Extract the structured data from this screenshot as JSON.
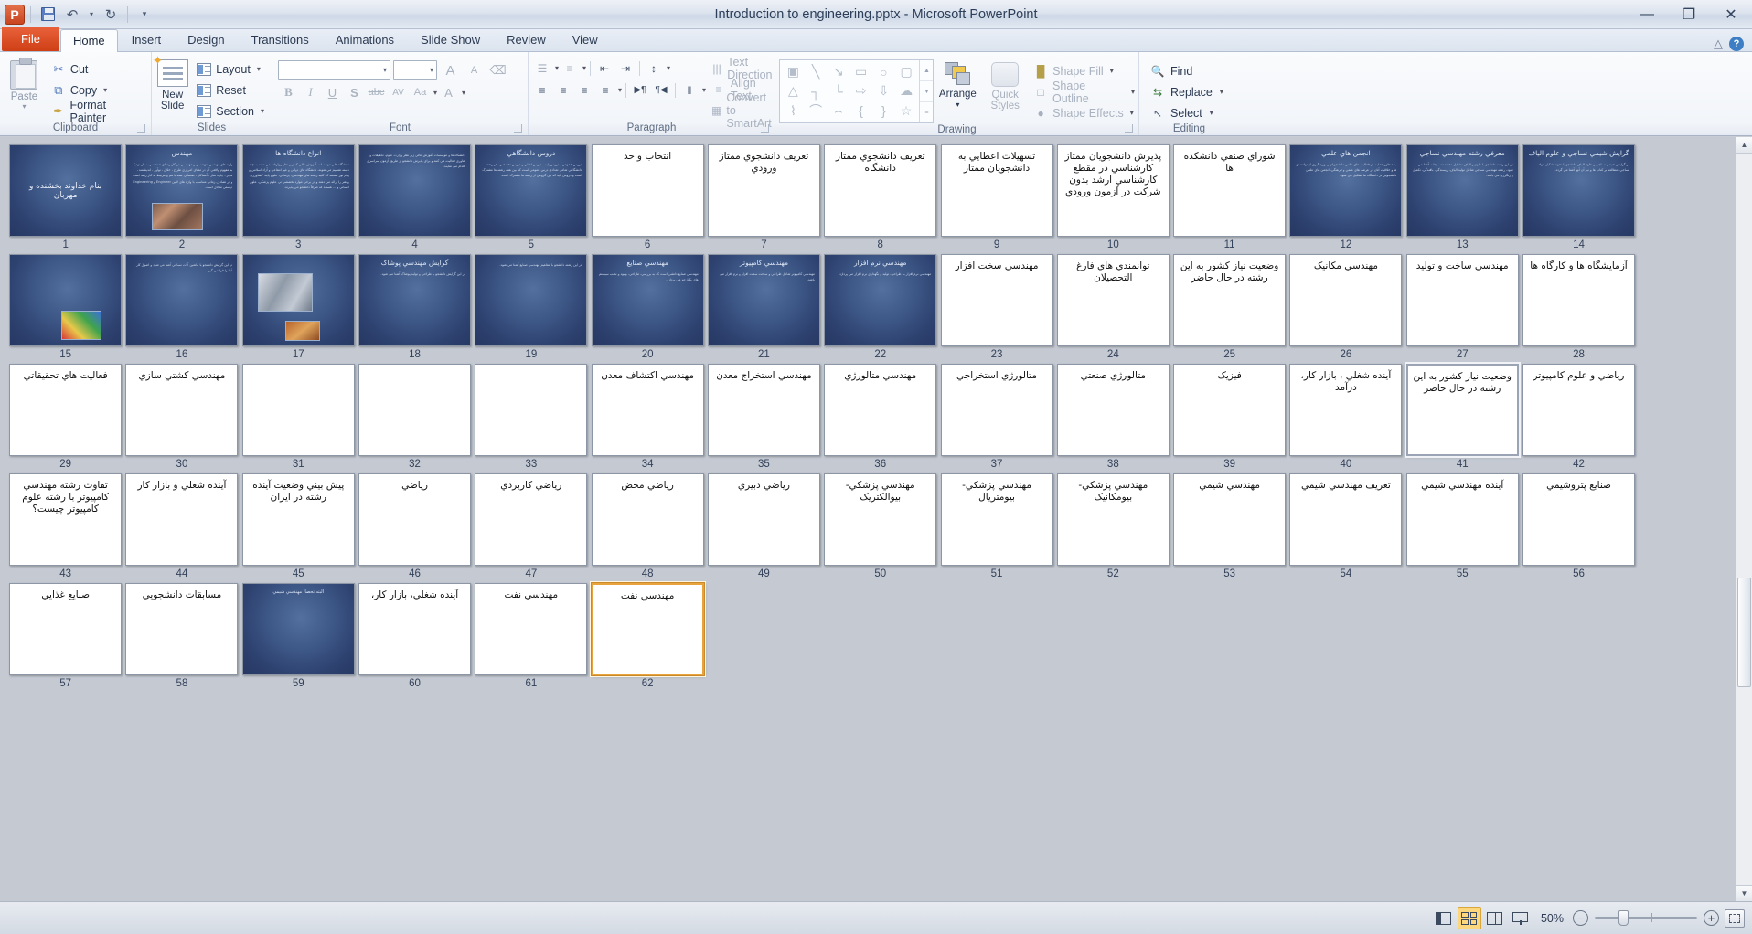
{
  "window": {
    "title": "Introduction to engineering.pptx  -  Microsoft PowerPoint",
    "app_logo": "P",
    "minimize": "—",
    "restore": "❐",
    "close": "✕"
  },
  "quick_access": {
    "save_tooltip": "Save",
    "undo": "↶",
    "undo_caret": "▾",
    "redo": "↻",
    "customize": "▾"
  },
  "tabs": [
    {
      "label": "File",
      "kind": "file"
    },
    {
      "label": "Home",
      "kind": "active"
    },
    {
      "label": "Insert",
      "kind": "normal"
    },
    {
      "label": "Design",
      "kind": "normal"
    },
    {
      "label": "Transitions",
      "kind": "normal"
    },
    {
      "label": "Animations",
      "kind": "normal"
    },
    {
      "label": "Slide Show",
      "kind": "normal"
    },
    {
      "label": "Review",
      "kind": "normal"
    },
    {
      "label": "View",
      "kind": "normal"
    }
  ],
  "tab_right": {
    "minimize_ribbon": "△",
    "help": "?"
  },
  "ribbon": {
    "groups": [
      {
        "name": "Clipboard",
        "label": "Clipboard"
      },
      {
        "name": "Slides",
        "label": "Slides"
      },
      {
        "name": "Font",
        "label": "Font"
      },
      {
        "name": "Paragraph",
        "label": "Paragraph"
      },
      {
        "name": "Drawing",
        "label": "Drawing"
      },
      {
        "name": "Editing",
        "label": "Editing"
      }
    ],
    "clipboard": {
      "paste": "Paste",
      "paste_caret": "▾",
      "cut": "Cut",
      "copy": "Copy",
      "format_painter": "Format Painter",
      "cut_icon": "✂",
      "copy_icon": "⧉",
      "painter_icon": "✒"
    },
    "slides": {
      "new_slide_line1": "New",
      "new_slide_line2": "Slide",
      "new_slide_caret": "▾",
      "layout": "Layout",
      "reset": "Reset",
      "section": "Section",
      "caret": "▾"
    },
    "font": {
      "font_name_value": "",
      "font_size_value": "",
      "grow_font": "A",
      "shrink_font": "A",
      "clear_formatting": "⌫",
      "bold": "B",
      "italic": "I",
      "underline": "U",
      "shadow": "S",
      "strikethrough": "abc",
      "char_spacing": "AV",
      "change_case": "Aa",
      "font_color": "A"
    },
    "paragraph": {
      "bullets": "☰",
      "numbering": "≡",
      "decrease_indent": "⇤",
      "increase_indent": "⇥",
      "line_spacing": "↕",
      "align_left": "≡",
      "align_center": "≡",
      "align_right": "≡",
      "justify": "≡",
      "columns": "‖",
      "ltr": "▶¶",
      "rtl": "¶◀",
      "text_direction": "Text Direction",
      "align_text": "Align Text",
      "convert_smartart": "Convert to SmartArt",
      "caret": "▾"
    },
    "drawing": {
      "shapes": [
        "▣",
        "╲",
        "↘",
        "▭",
        "○",
        "▢",
        "△",
        "┐",
        "└",
        "⇨",
        "⇩",
        "☁",
        "⌇",
        "⌒",
        "⌢",
        "{",
        "}",
        "☆"
      ],
      "scroll_up": "▲",
      "scroll_down": "▼",
      "scroll_more": "≡",
      "arrange": "Arrange",
      "quick_styles_line1": "Quick",
      "quick_styles_line2": "Styles",
      "shape_fill": "Shape Fill",
      "shape_outline": "Shape Outline",
      "shape_effects": "Shape Effects",
      "caret": "▾"
    },
    "editing": {
      "find": "Find",
      "replace": "Replace",
      "select": "Select",
      "find_icon": "🔍",
      "replace_icon": "⇆",
      "select_icon": "↖",
      "caret": "▾"
    }
  },
  "slides": [
    {
      "n": "1",
      "style": "dark",
      "layout": "center",
      "title": "بنام خداوند بخشنده و مهربان",
      "body": ""
    },
    {
      "n": "2",
      "style": "dark",
      "layout": "title-body-pic",
      "title": "مهندس",
      "body": "واژه هاي مهندس، مهندسي و مهندسي در کاربردهاي صنعت و بسيار نزديک به مفهوم واقعي آن در معناي امروزي طراح ، خلاق ، نوآور ، انديشمند ، مدير ، چاره ساز ، آشناکار ، صنعتگر، همه با هم و مرتبط به کار رفته است و در تصادف زماني متناسب با واژه هاي لاتين Engineer و Engineering درستي معادل است.",
      "pic": "pic-a"
    },
    {
      "n": "3",
      "style": "dark",
      "layout": "title-body",
      "title": "انواع دانشگاه ها",
      "body": "دانشگاه ها و موسسات آموزش عالي که زير نظر وزارتانه مي دهند به چند دسته تقسيم مي شوند، دانشگاه هاي دولتي و غير انتفاعي و آزاد اسلامي و پيام نور هستند که کليه رشته هاي مهندسي، پزشکي، علوم پايه، کشاورزي و هنر را ارائه مي دهند و در برخي موارد تخصصي تر، علوم پزشکي، علوم انساني و ... هستند که صرفاً دانشجو مي پذيرند."
    },
    {
      "n": "4",
      "style": "dark",
      "layout": "title-body",
      "title": "",
      "body": "دانشگاه ها و موسسات آموزش عالي زير نظر وزارت علوم، تحقيقات و فناوري فعاليت مي کنند و براي پذيرش دانشجو از طريق آزمون سراسري اقدام مي نمايند."
    },
    {
      "n": "5",
      "style": "dark",
      "layout": "title-body",
      "title": "دروس دانشگاهي",
      "body": "دروس عمومي ، دروس پايه ، دروس اصلي و دروس تخصصي، هر رشته دانشگاهي شامل تعدادي درس عمومي است که بين همه رشته ها مشترک است و دروس پايه که بين گروهي از رشته ها مشترک است."
    },
    {
      "n": "6",
      "style": "light",
      "layout": "title",
      "title": "انتخاب واحد"
    },
    {
      "n": "7",
      "style": "light",
      "layout": "title",
      "title": "تعريف دانشجوي ممتاز ورودي"
    },
    {
      "n": "8",
      "style": "light",
      "layout": "title",
      "title": "تعريف دانشجوي ممتاز دانشگاه"
    },
    {
      "n": "9",
      "style": "light",
      "layout": "title",
      "title": "تسهيلات اعطايي به دانشجويان ممتاز"
    },
    {
      "n": "10",
      "style": "light",
      "layout": "title",
      "title": "پذيرش دانشجويان ممتاز کارشناسي در مقطع کارشناسي ارشد بدون شرکت در آزمون ورودي"
    },
    {
      "n": "11",
      "style": "light",
      "layout": "title",
      "title": "شوراي صنفي دانشکده ها"
    },
    {
      "n": "12",
      "style": "dark",
      "layout": "title-body",
      "title": "انجمن هاي علمي",
      "body": "به منظور حمايت از فعاليت هاي علمي دانشجويان و بهره گيري از توانمندي ها و خلاقيت آنان در عرصه هاي علمي و فرهنگي، انجمن هاي علمي دانشجويي در دانشگاه ها تشکيل مي شود."
    },
    {
      "n": "13",
      "style": "dark",
      "layout": "title-body",
      "title": "معرفي رشته مهندسي نساجي",
      "body": "در اين رشته دانشجو با علوم و الياف تشکيل دهنده منسوجات آشنا مي شود، رشته مهندسي نساجي شامل توليد الياف، ريسندگي، بافندگي، تکميل و رنگرزي مي باشد."
    },
    {
      "n": "14",
      "style": "dark",
      "layout": "title-body",
      "title": "گرايش شيمي نساجي و علوم الياف",
      "body": "در گرايش شيمي نساجي و علوم الياف دانشجو با نحوه تشکيل مواد نساجي، مطالعه بر کتاب ها و نيز آن آنها آشنا مي گردد."
    },
    {
      "n": "15",
      "style": "dark",
      "layout": "pic-only",
      "title": "",
      "body": "",
      "pic": "pic-e"
    },
    {
      "n": "16",
      "style": "dark",
      "layout": "title-body",
      "title": "",
      "body": "در اين گرايش دانشجو با ماشين آلات نساجي آشنا مي شود و اصول کار آنها را فرا مي گيرد."
    },
    {
      "n": "17",
      "style": "dark",
      "layout": "pic-two",
      "title": "",
      "body": "",
      "pic": "pic-b",
      "pic2": "pic-c"
    },
    {
      "n": "18",
      "style": "dark",
      "layout": "title-body",
      "title": "گرايش مهندسي پوشاک",
      "body": "در اين گرايش دانشجو با طراحي و توليد پوشاک آشنا مي شود."
    },
    {
      "n": "19",
      "style": "dark",
      "layout": "title-body",
      "title": "",
      "body": "در اين رشته دانشجو با مفاهيم مهندسي صنايع آشنا مي شود."
    },
    {
      "n": "20",
      "style": "dark",
      "layout": "title-body",
      "title": "مهندسي صنايع",
      "body": "مهندسي صنايع دانشي است که به بررسي، طراحي، بهبود و نصب سيستم هاي يکپارچه مي پردازد."
    },
    {
      "n": "21",
      "style": "dark",
      "layout": "title-body",
      "title": "مهندسي کامپيوتر",
      "body": "مهندسي کامپيوتر شامل طراحي و ساخت سخت افزار و نرم افزار مي باشد."
    },
    {
      "n": "22",
      "style": "dark",
      "layout": "title-body",
      "title": "مهندسي نرم افزار",
      "body": "مهندسي نرم افزار به طراحي، توليد و نگهداري نرم افزار مي پردازد."
    },
    {
      "n": "23",
      "style": "light",
      "layout": "title",
      "title": "مهندسي سخت افزار"
    },
    {
      "n": "24",
      "style": "light",
      "layout": "title",
      "title": "توانمندي هاي فارغ التحصيلان"
    },
    {
      "n": "25",
      "style": "light",
      "layout": "title",
      "title": "وضعيت نياز کشور به اين رشته در حال حاضر"
    },
    {
      "n": "26",
      "style": "light",
      "layout": "title",
      "title": "مهندسي مکانيک"
    },
    {
      "n": "27",
      "style": "light",
      "layout": "title",
      "title": "مهندسي ساخت و توليد"
    },
    {
      "n": "28",
      "style": "light",
      "layout": "title",
      "title": "آزمايشگاه ها و کارگاه ها"
    },
    {
      "n": "29",
      "style": "light",
      "layout": "title",
      "title": "فعاليت هاي تحقيقاتي"
    },
    {
      "n": "30",
      "style": "light",
      "layout": "title",
      "title": "مهندسي کشتي سازي"
    },
    {
      "n": "31",
      "style": "light",
      "layout": "blank",
      "title": ""
    },
    {
      "n": "32",
      "style": "light",
      "layout": "blank",
      "title": ""
    },
    {
      "n": "33",
      "style": "light",
      "layout": "blank",
      "title": ""
    },
    {
      "n": "34",
      "style": "light",
      "layout": "title",
      "title": "مهندسي اکتشاف معدن"
    },
    {
      "n": "35",
      "style": "light",
      "layout": "title",
      "title": "مهندسي استخراج معدن"
    },
    {
      "n": "36",
      "style": "light",
      "layout": "title",
      "title": "مهندسي متالورژي"
    },
    {
      "n": "37",
      "style": "light",
      "layout": "title",
      "title": "متالورژي استخراجي"
    },
    {
      "n": "38",
      "style": "light",
      "layout": "title",
      "title": "متالورژي صنعتي"
    },
    {
      "n": "39",
      "style": "light",
      "layout": "title",
      "title": "فيزيک"
    },
    {
      "n": "40",
      "style": "light",
      "layout": "title",
      "title": "آينده شغلي ، بازار کار، درآمد"
    },
    {
      "n": "41",
      "style": "light",
      "layout": "title",
      "title": "وضعيت نياز کشور به اين رشته در حال حاضر",
      "selected": true
    },
    {
      "n": "42",
      "style": "light",
      "layout": "title",
      "title": "رياضي و علوم کامپيوتر"
    },
    {
      "n": "43",
      "style": "light",
      "layout": "title",
      "title": "تفاوت رشته مهندسي کامپيوتر با رشته علوم کامپيوتر چيست؟"
    },
    {
      "n": "44",
      "style": "light",
      "layout": "title",
      "title": "آينده شغلي و بازار کار"
    },
    {
      "n": "45",
      "style": "light",
      "layout": "title",
      "title": "پيش بيني وضعيت آينده رشته در ايران"
    },
    {
      "n": "46",
      "style": "light",
      "layout": "title",
      "title": "رياضي"
    },
    {
      "n": "47",
      "style": "light",
      "layout": "title",
      "title": "رياضي کاربردي"
    },
    {
      "n": "48",
      "style": "light",
      "layout": "title",
      "title": "رياضي محض"
    },
    {
      "n": "49",
      "style": "light",
      "layout": "title",
      "title": "رياضي دبيري"
    },
    {
      "n": "50",
      "style": "light",
      "layout": "title",
      "title": "مهندسي پزشکي-بيوالکتريک"
    },
    {
      "n": "51",
      "style": "light",
      "layout": "title",
      "title": "مهندسي پزشکي-بيومتريال"
    },
    {
      "n": "52",
      "style": "light",
      "layout": "title",
      "title": "مهندسي پزشکي-بيومکانيک"
    },
    {
      "n": "53",
      "style": "light",
      "layout": "title",
      "title": "مهندسي شيمي"
    },
    {
      "n": "54",
      "style": "light",
      "layout": "title",
      "title": "تعريف مهندسي شيمي"
    },
    {
      "n": "55",
      "style": "light",
      "layout": "title",
      "title": "آينده مهندسي شيمي"
    },
    {
      "n": "56",
      "style": "light",
      "layout": "title",
      "title": "صنايع پتروشيمي"
    },
    {
      "n": "57",
      "style": "light",
      "layout": "title",
      "title": "صنايع غذايي"
    },
    {
      "n": "58",
      "style": "light",
      "layout": "title",
      "title": "مسابقات دانشجويي"
    },
    {
      "n": "59",
      "style": "dark",
      "layout": "title-small",
      "title": "البته تحصا، مهندسي شيمي"
    },
    {
      "n": "60",
      "style": "light",
      "layout": "title",
      "title": "آينده شغلي، بازار کار،"
    },
    {
      "n": "61",
      "style": "light",
      "layout": "title",
      "title": "مهندسي نفت"
    },
    {
      "n": "62",
      "style": "light",
      "layout": "title",
      "title": "مهندسي نفت",
      "active": true
    }
  ],
  "statusbar": {
    "view_normal": "normal-view-icon",
    "view_sorter": "slide-sorter-view-icon",
    "view_reading": "reading-view-icon",
    "view_show": "slide-show-icon",
    "zoom_level": "50%",
    "zoom_out": "−",
    "zoom_in": "+",
    "fit_window": "fit-slide-to-window-icon"
  }
}
